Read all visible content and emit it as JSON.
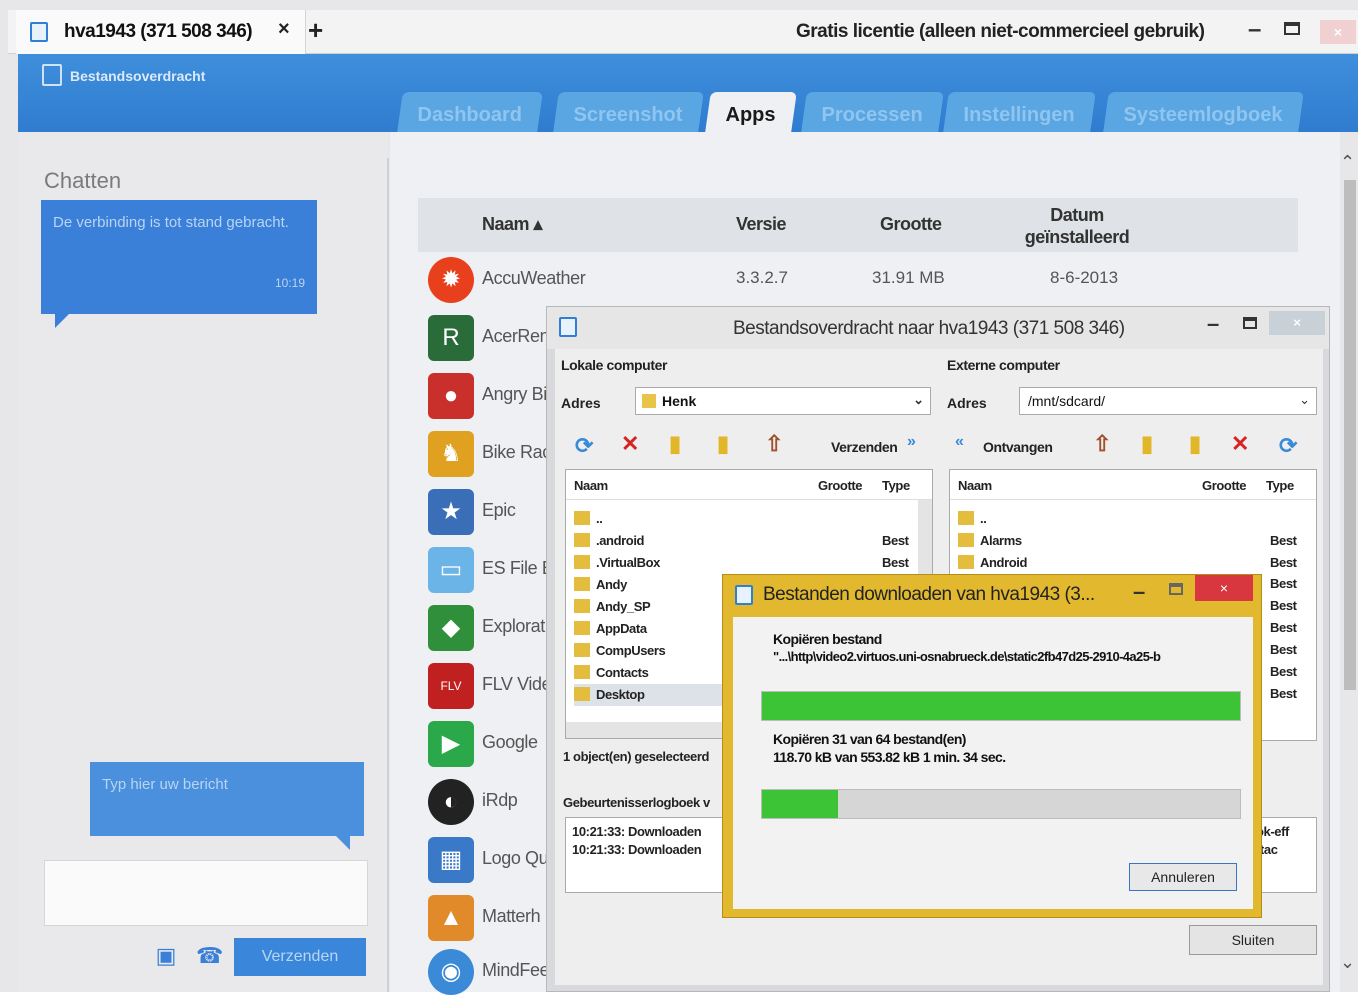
{
  "window": {
    "tab_title": "hva1943 (371 508 346)",
    "tab_close": "×",
    "tab_add": "+",
    "license": "Gratis licentie (alleen niet-commercieel gebruik)",
    "min": "–",
    "close": "×"
  },
  "header": {
    "title": "Bestandsoverdracht",
    "tabs": [
      {
        "label": "Dashboard"
      },
      {
        "label": "Screenshot"
      },
      {
        "label": "Apps"
      },
      {
        "label": "Processen"
      },
      {
        "label": "Instellingen"
      },
      {
        "label": "Systeemlogboek"
      }
    ],
    "active_tab": "Apps"
  },
  "chat": {
    "title": "Chatten",
    "message": "De verbinding is tot stand gebracht.",
    "message_time": "10:19",
    "type_placeholder": "Typ hier uw bericht",
    "send_label": "Verzenden"
  },
  "apps": {
    "columns": {
      "name": "Naam ▴",
      "version": "Versie",
      "size": "Grootte",
      "installed": "Datum geïnstalleerd"
    },
    "rows": [
      {
        "name": "AccuWeather",
        "version": "3.3.2.7",
        "size": "31.91 MB",
        "date": "8-6-2013",
        "icon": "sun-icon",
        "color": "#e8401c"
      },
      {
        "name": "AcerRem",
        "icon": "remote-icon",
        "color": "#2a6b3a"
      },
      {
        "name": "Angry Bi",
        "icon": "bird-icon",
        "color": "#c9302c"
      },
      {
        "name": "Bike Rac",
        "icon": "bike-icon",
        "color": "#e0a020"
      },
      {
        "name": "Epic",
        "icon": "game-icon",
        "color": "#3a6fb8"
      },
      {
        "name": "ES File E",
        "icon": "folder-app-icon",
        "color": "#6ab4e8"
      },
      {
        "name": "Explorat",
        "icon": "shield-icon",
        "color": "#2f8f3a"
      },
      {
        "name": "FLV Vide",
        "icon": "video-icon",
        "color": "#c02020"
      },
      {
        "name": "Google",
        "icon": "play-icon",
        "color": "#2aa84a"
      },
      {
        "name": "iRdp",
        "icon": "rdp-icon",
        "color": "#222222"
      },
      {
        "name": "Logo Qu",
        "icon": "quiz-icon",
        "color": "#3a78c8"
      },
      {
        "name": "Matterh",
        "icon": "mountain-icon",
        "color": "#e08a2a"
      },
      {
        "name": "MindFee",
        "icon": "mind-icon",
        "color": "#3a8ad8"
      }
    ]
  },
  "transfer": {
    "title": "Bestandsoverdracht naar hva1943 (371 508 346)",
    "local_label": "Lokale computer",
    "remote_label": "Externe computer",
    "addr_label": "Adres",
    "local_addr": "Henk",
    "remote_addr": "/mnt/sdcard/",
    "send_label": "Verzenden",
    "receive_label": "Ontvangen",
    "col_name": "Naam",
    "col_size": "Grootte",
    "col_type": "Type",
    "local_files": [
      {
        "name": "..",
        "type": ""
      },
      {
        "name": ".android",
        "type": "Best"
      },
      {
        "name": ".VirtualBox",
        "type": "Best"
      },
      {
        "name": "Andy",
        "type": ""
      },
      {
        "name": "Andy_SP",
        "type": ""
      },
      {
        "name": "AppData",
        "type": ""
      },
      {
        "name": "CompUsers",
        "type": ""
      },
      {
        "name": "Contacts",
        "type": ""
      },
      {
        "name": "Desktop",
        "type": ""
      }
    ],
    "remote_files": [
      {
        "name": "..",
        "type": ""
      },
      {
        "name": "Alarms",
        "type": "Best"
      },
      {
        "name": "Android",
        "type": "Best"
      }
    ],
    "remote_types_extra": [
      "Best",
      "Best",
      "Best",
      "Best",
      "Best",
      "Best"
    ],
    "selected": "1 object(en) geselecteerd",
    "log_label": "Gebeurtenisserlogboek v",
    "log_lines": [
      "10:21:33: Downloaden",
      "10:21:33: Downloaden"
    ],
    "log_right": [
      "ok-eff",
      "ttac"
    ],
    "close_label": "Sluiten"
  },
  "download": {
    "title": "Bestanden downloaden van hva1943 (3...",
    "copy_label": "Kopiëren bestand",
    "file_path": "\"...\\http\\video2.virtuos.uni-osnabrueck.de\\static2fb47d25-2910-4a25-b",
    "progress_file": 1.0,
    "count_text": "Kopiëren 31 van 64 bestand(en)",
    "bytes_text": "118.70 kB van 553.82 kB    1 min. 34 sec.",
    "progress_total": 0.16,
    "cancel_label": "Annuleren",
    "colors": {
      "progress": "#3cc436",
      "frame": "#e2b82f"
    }
  }
}
